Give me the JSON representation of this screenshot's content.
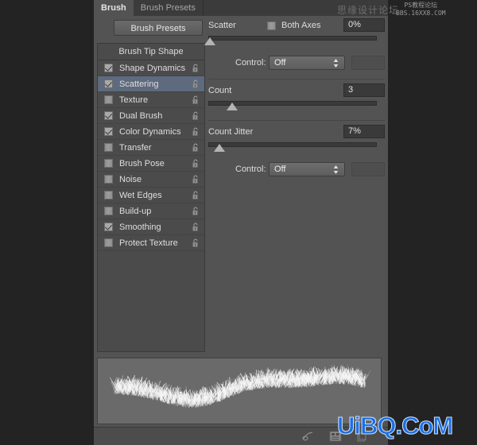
{
  "window": {
    "background_color": "#232323",
    "panel_color": "#535353"
  },
  "tabs": [
    {
      "label": "Brush",
      "active": true
    },
    {
      "label": "Brush Presets",
      "active": false
    }
  ],
  "toolbar": {
    "brush_presets_button": "Brush Presets"
  },
  "brush_list": {
    "header": "Brush Tip Shape",
    "items": [
      {
        "label": "Shape Dynamics",
        "checked": true,
        "selected": false,
        "locked": false
      },
      {
        "label": "Scattering",
        "checked": true,
        "selected": true,
        "locked": false
      },
      {
        "label": "Texture",
        "checked": false,
        "selected": false,
        "locked": false
      },
      {
        "label": "Dual Brush",
        "checked": true,
        "selected": false,
        "locked": false
      },
      {
        "label": "Color Dynamics",
        "checked": true,
        "selected": false,
        "locked": false
      },
      {
        "label": "Transfer",
        "checked": false,
        "selected": false,
        "locked": false
      },
      {
        "label": "Brush Pose",
        "checked": false,
        "selected": false,
        "locked": false
      },
      {
        "label": "Noise",
        "checked": false,
        "selected": false,
        "locked": false
      },
      {
        "label": "Wet Edges",
        "checked": false,
        "selected": false,
        "locked": false
      },
      {
        "label": "Build-up",
        "checked": false,
        "selected": false,
        "locked": false
      },
      {
        "label": "Smoothing",
        "checked": true,
        "selected": false,
        "locked": false
      },
      {
        "label": "Protect Texture",
        "checked": false,
        "selected": false,
        "locked": false
      }
    ],
    "lock_icon": "unlocked-padlock-icon"
  },
  "scattering_panel": {
    "scatter": {
      "label": "Scatter",
      "value": "0%",
      "slider_percent": 0,
      "both_axes": {
        "label": "Both Axes",
        "checked": false
      },
      "control": {
        "label": "Control:",
        "value": "Off"
      }
    },
    "count": {
      "label": "Count",
      "value": "3",
      "slider_percent": 14
    },
    "count_jitter": {
      "label": "Count Jitter",
      "value": "7%",
      "slider_percent": 7,
      "control": {
        "label": "Control:",
        "value": "Off"
      }
    }
  },
  "preview": {
    "name": "brush-stroke-preview",
    "stroke_color": "#ffffff",
    "background_color": "#6a6a6a"
  },
  "bottom_bar": {
    "icons": [
      {
        "name": "new-brush-preset-icon"
      },
      {
        "name": "toggle-brush-panel-icon"
      },
      {
        "name": "delete-brush-icon"
      }
    ]
  },
  "watermarks": {
    "chinese_top": "思缘设计论坛",
    "url_line1": "PS教程论坛",
    "url_line2": "BBS.16XX8.COM",
    "bottom_brand": "UiBQ.CoM",
    "bottom_brand_color": "#1d6fe0"
  }
}
